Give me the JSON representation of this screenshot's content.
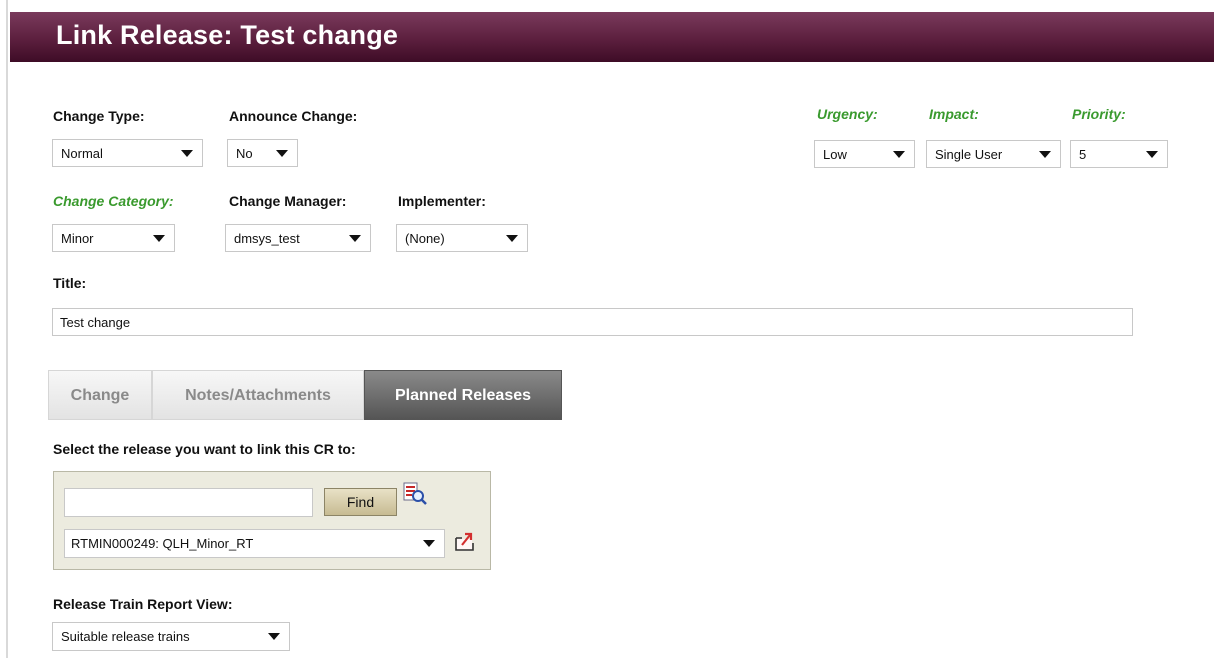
{
  "header": {
    "title": "Link Release: Test change"
  },
  "fields": {
    "change_type": {
      "label": "Change Type:",
      "value": "Normal"
    },
    "announce_change": {
      "label": "Announce Change:",
      "value": "No"
    },
    "urgency": {
      "label": "Urgency:",
      "value": "Low"
    },
    "impact": {
      "label": "Impact:",
      "value": "Single User"
    },
    "priority": {
      "label": "Priority:",
      "value": "5"
    },
    "change_category": {
      "label": "Change Category:",
      "value": "Minor"
    },
    "change_manager": {
      "label": "Change Manager:",
      "value": "dmsys_test"
    },
    "implementer": {
      "label": "Implementer:",
      "value": "(None)"
    },
    "title": {
      "label": "Title:",
      "value": "Test change"
    }
  },
  "tabs": [
    {
      "label": "Change",
      "active": false
    },
    {
      "label": "Notes/Attachments",
      "active": false
    },
    {
      "label": "Planned Releases",
      "active": true
    }
  ],
  "release": {
    "prompt": "Select the release you want to link this CR to:",
    "search_value": "",
    "find_label": "Find",
    "selected": "RTMIN000249: QLH_Minor_RT",
    "report_view_label": "Release Train Report View:",
    "report_view_value": "Suitable release trains"
  },
  "icons": {
    "search": "search-report-icon",
    "link": "link-release-icon"
  },
  "colors": {
    "header_bg": "#5c1f3e",
    "green_label": "#3a9a2e",
    "active_tab": "#6a6a6a",
    "find_panel": "#ecebdf"
  }
}
